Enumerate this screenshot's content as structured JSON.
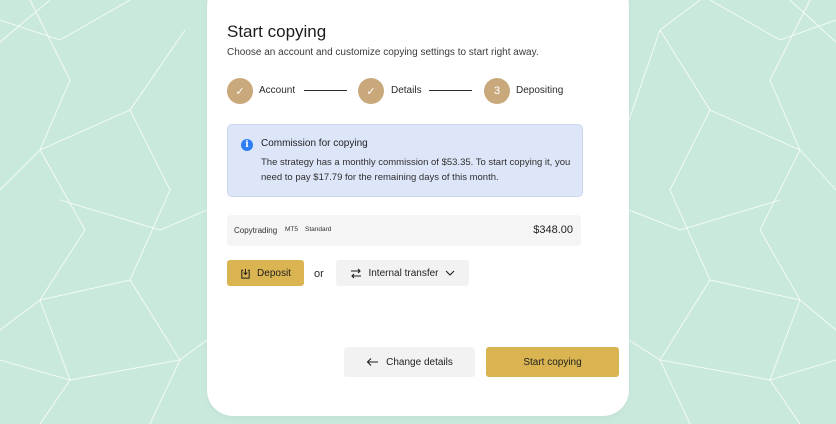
{
  "header": {
    "title": "Start copying",
    "subtitle": "Choose an account and customize copying settings to start right away."
  },
  "steps": [
    {
      "label": "Account",
      "marker": "✓",
      "status": "completed"
    },
    {
      "label": "Details",
      "marker": "✓",
      "status": "completed"
    },
    {
      "label": "Depositing",
      "marker": "3",
      "status": "current"
    }
  ],
  "notice": {
    "title": "Commission for copying",
    "text": "The strategy has a monthly commission of $53.35. To start copying it, you need to pay $17.79 for the remaining days of this month.",
    "icon": "info-icon"
  },
  "account": {
    "name": "Copytrading",
    "platform": "MT5",
    "type": "Standard",
    "balance": "$348.00"
  },
  "funding": {
    "deposit_label": "Deposit",
    "or_label": "or",
    "transfer_label": "Internal transfer"
  },
  "footer": {
    "change_label": "Change details",
    "start_label": "Start copying"
  },
  "colors": {
    "background": "#c9e9dc",
    "step_accent": "#c9a97c",
    "primary_button": "#d9b451",
    "notice_bg": "#dde6f8",
    "info_icon": "#2f7df4"
  }
}
